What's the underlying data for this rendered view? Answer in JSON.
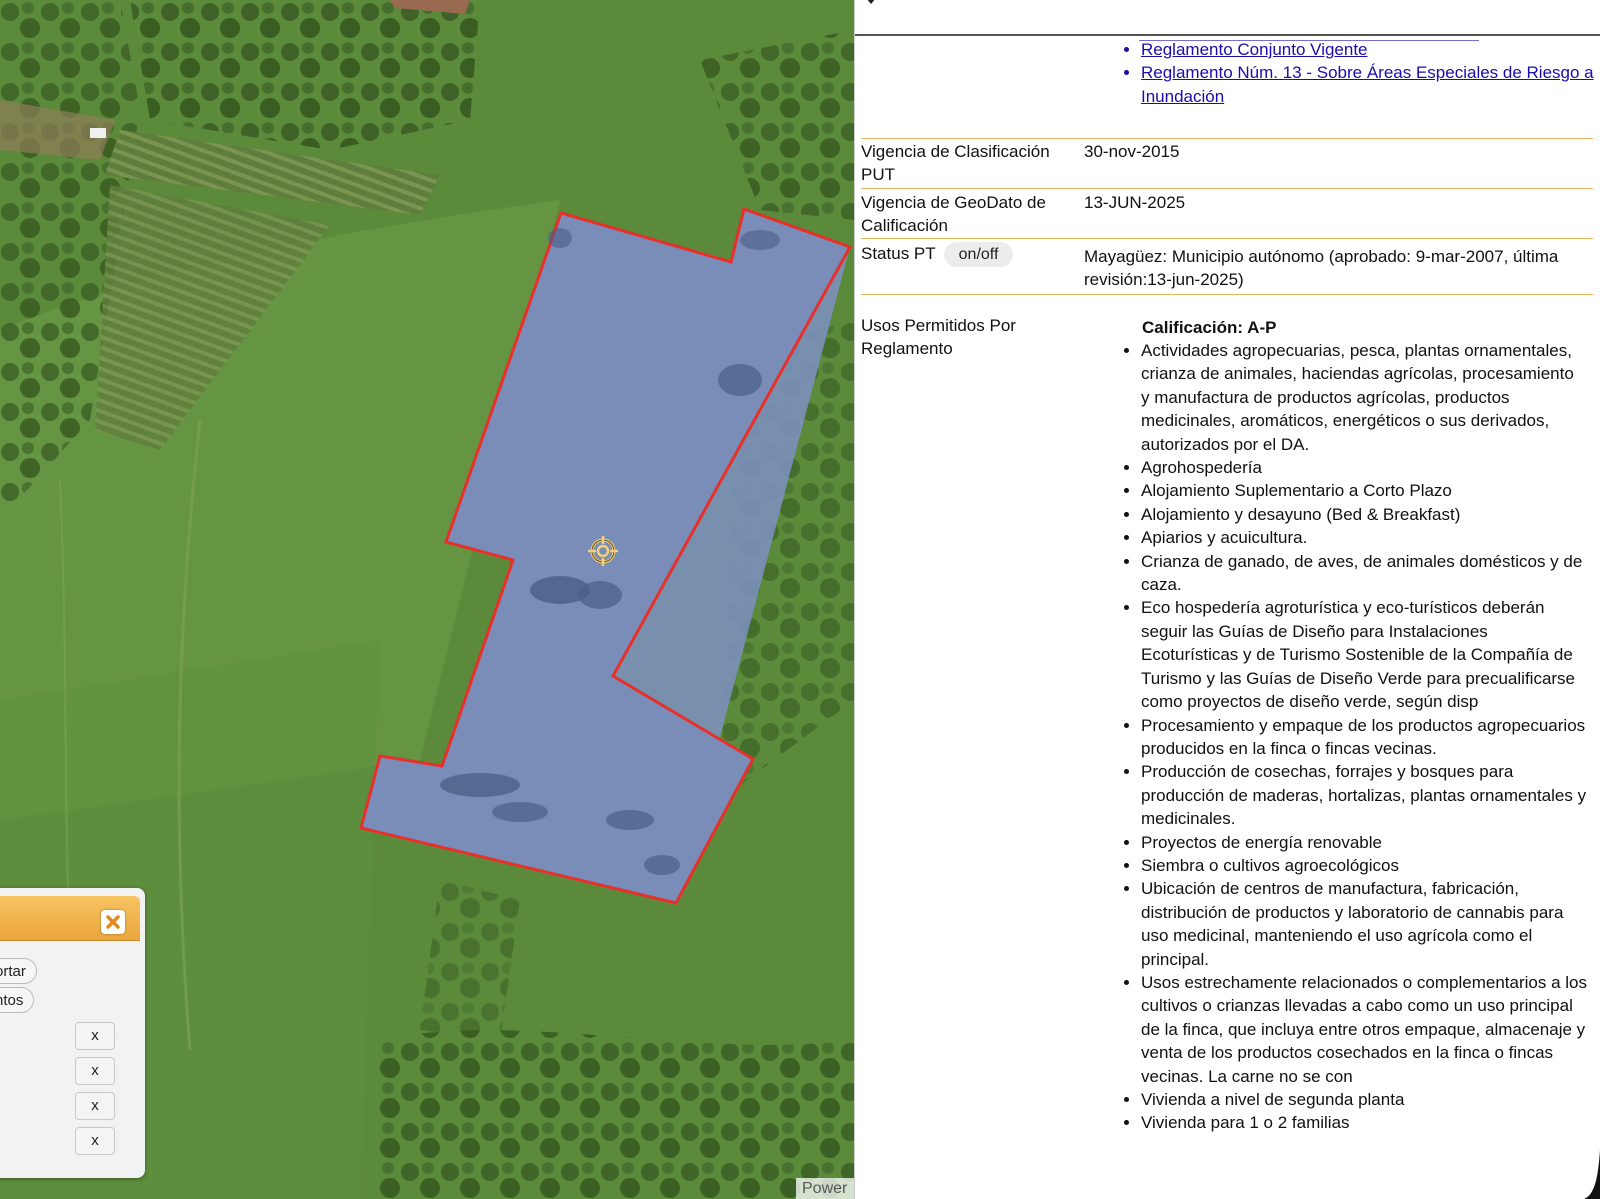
{
  "map": {
    "attribution": "Power",
    "icons": [
      "crosshair-icon"
    ],
    "colors": {
      "parcel_outline": "#e8302a",
      "parcel_fill": "#7b8fb8",
      "vegetation": "#4f7a34"
    }
  },
  "tool_panel": {
    "pills": [
      "ortar",
      "ntos"
    ],
    "remove_labels": [
      "x",
      "x",
      "x",
      "x"
    ]
  },
  "info": {
    "links": [
      "Reglamento Conjunto Vigente",
      "Reglamento Núm. 13 - Sobre Áreas Especiales de Riesgo a Inundación"
    ],
    "rows": [
      {
        "label": "Vigencia de Clasificación PUT",
        "value": "30-nov-2015"
      },
      {
        "label": "Vigencia de GeoDato de Calificación",
        "value": "13-JUN-2025"
      },
      {
        "label": "Status PT",
        "toggle": "on/off",
        "value": "Mayagüez: Municipio autónomo (aprobado: 9-mar-2007, última revisión:13-jun-2025)"
      }
    ],
    "usos": {
      "label": "Usos Permitidos Por Reglamento",
      "title": "Calificación: A-P",
      "items": [
        "Actividades agropecuarias, pesca, plantas ornamentales, crianza de animales, haciendas agrícolas, procesamiento y manufactura de productos agrícolas, productos medicinales, aromáticos, energéticos o sus derivados, autorizados por el DA.",
        "Agrohospedería",
        "Alojamiento Suplementario a Corto Plazo",
        "Alojamiento y desayuno (Bed & Breakfast)",
        "Apiarios y acuicultura.",
        "Crianza de ganado, de aves, de animales domésticos y de caza.",
        "Eco hospedería agroturística y eco-turísticos deberán seguir las Guías de Diseño para Instalaciones Ecoturísticas y de Turismo Sostenible de la Compañía de Turismo y las Guías de Diseño Verde para precualificarse como proyectos de diseño verde, según disp",
        "Procesamiento y empaque de los productos agropecuarios producidos en la finca o fincas vecinas.",
        "Producción de cosechas, forrajes y bosques para producción de maderas, hortalizas, plantas ornamentales y medicinales.",
        "Proyectos de energía renovable",
        "Siembra o cultivos agroecológicos",
        "Ubicación de centros de manufactura, fabricación, distribución de productos y laboratorio de cannabis para uso medicinal, manteniendo el uso agrícola como el principal.",
        "Usos estrechamente relacionados o complementarios a los cultivos o crianzas llevadas a cabo como un uso principal de la finca, que incluya entre otros empaque, almacenaje y venta de los productos cosechados en la finca o fincas vecinas. La carne no se con",
        "Vivienda a nivel de segunda planta",
        "Vivienda para 1 o 2 familias"
      ]
    }
  }
}
